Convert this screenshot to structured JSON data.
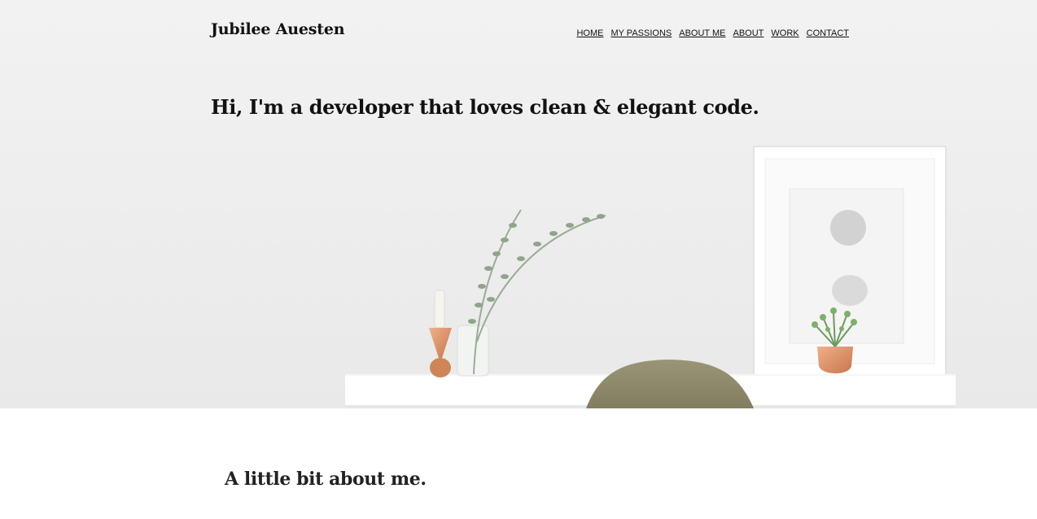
{
  "site": {
    "title": "Jubilee Auesten"
  },
  "nav": {
    "items": [
      {
        "label": "HOME"
      },
      {
        "label": "MY PASSIONS"
      },
      {
        "label": "ABOUT ME"
      },
      {
        "label": "ABOUT"
      },
      {
        "label": "WORK"
      },
      {
        "label": "CONTACT"
      }
    ]
  },
  "hero": {
    "heading": "Hi, I'm a developer that loves clean & elegant code."
  },
  "about": {
    "heading": "A little bit about me."
  },
  "colors": {
    "hero_background": "#efefef",
    "text": "#111111",
    "chair": "#8c8668",
    "copper": "#d4885a"
  }
}
